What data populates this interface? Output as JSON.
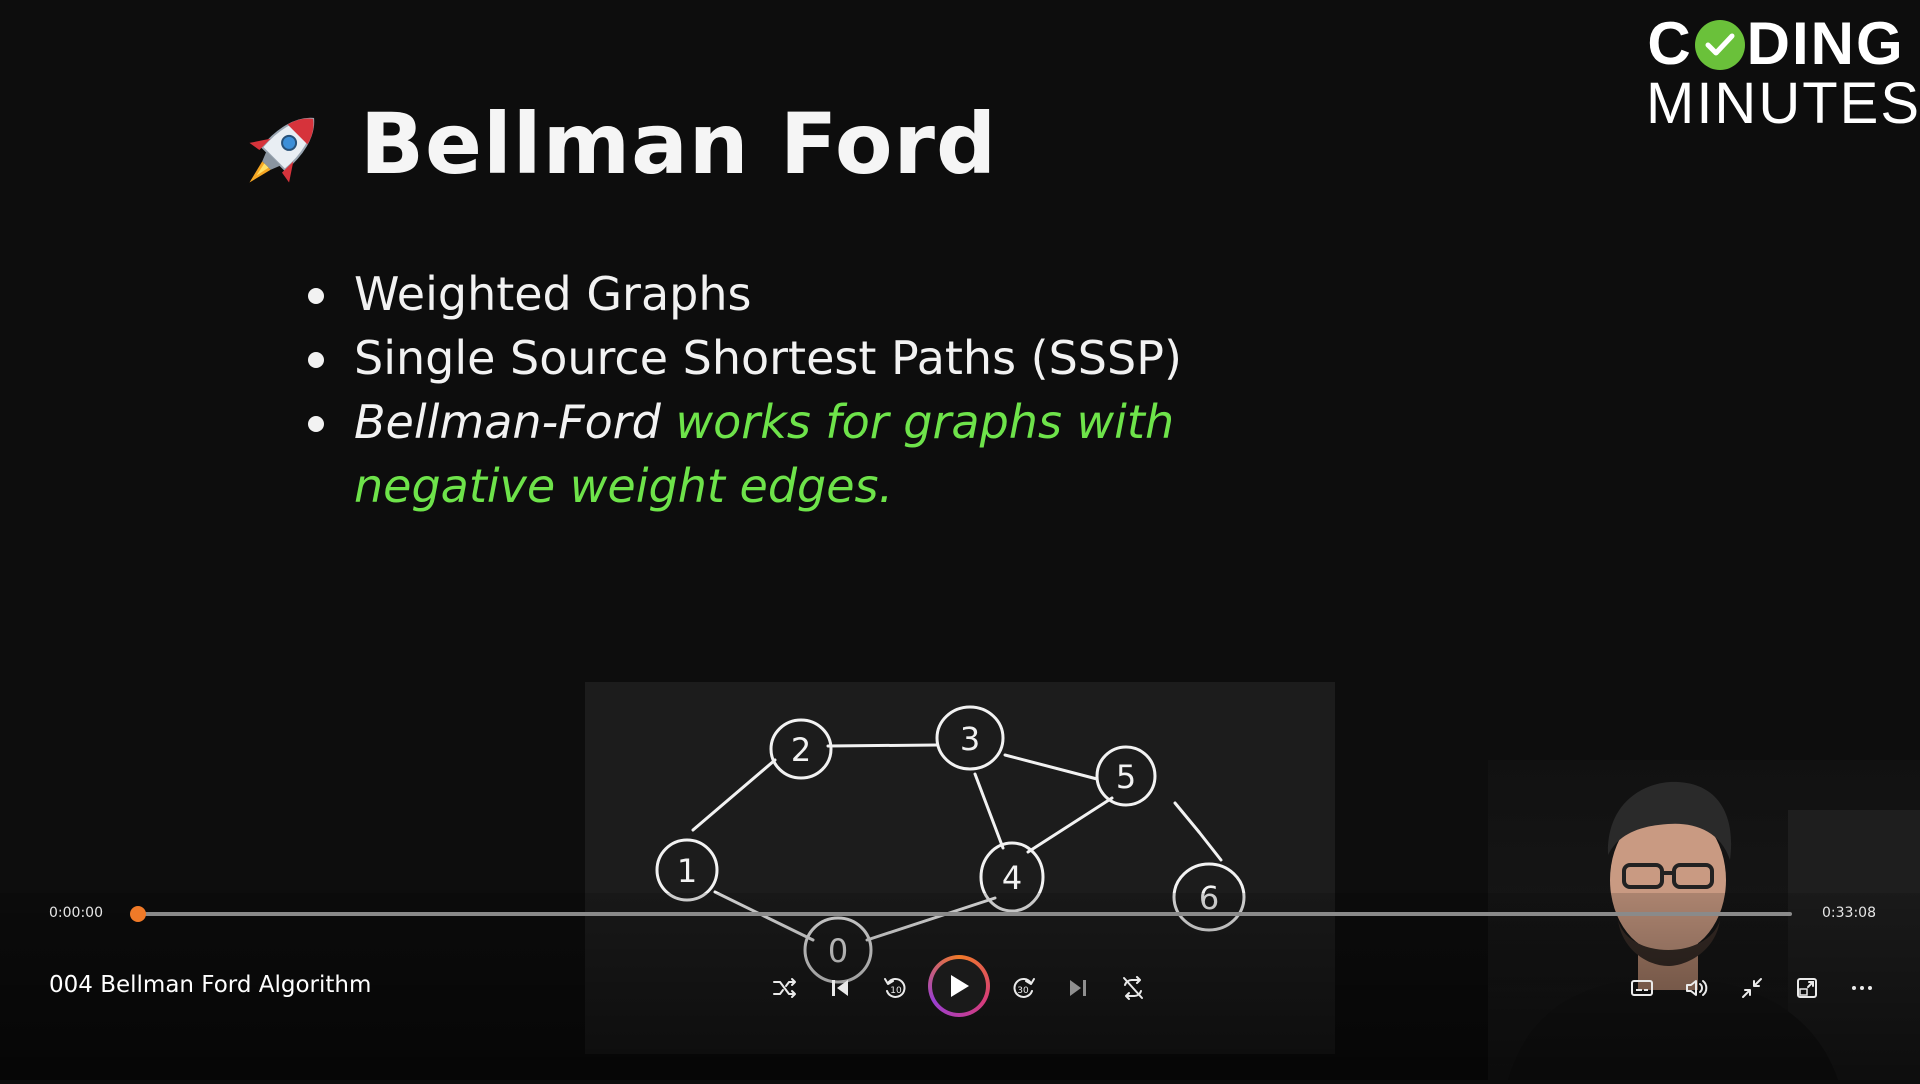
{
  "slide": {
    "title": "Bellman Ford",
    "bullets": {
      "b1": "Weighted Graphs",
      "b2": "Single Source Shortest Paths (SSSP)",
      "b3_italic": "Bellman-Ford",
      "b3_green": "works for graphs with negative weight edges."
    },
    "logo": {
      "c": "C",
      "rest": "DING",
      "line2": "MINUTES"
    },
    "graph": {
      "nodes": [
        "0",
        "1",
        "2",
        "3",
        "4",
        "5",
        "6"
      ]
    }
  },
  "player": {
    "current_time": "0:00:00",
    "duration": "0:33:08",
    "progress_fraction": 0.0,
    "video_title": "004 Bellman Ford Algorithm",
    "controls": {
      "left_group": [
        "shuffle-icon",
        "previous-icon",
        "rewind-10-icon",
        "play-icon",
        "forward-30-icon",
        "next-icon",
        "repeat-off-icon"
      ],
      "right_group": [
        "subtitles-icon",
        "volume-icon",
        "exit-fullscreen-icon",
        "mini-player-icon",
        "more-options-icon"
      ]
    },
    "colors": {
      "accent": "#f07a28",
      "green_text": "#6ee34a",
      "logo_check": "#6ac13a"
    }
  }
}
